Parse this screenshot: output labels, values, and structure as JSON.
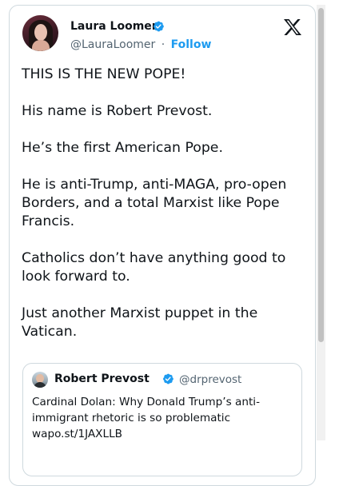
{
  "author": {
    "name": "Laura Loomer",
    "handle": "@LauraLoomer",
    "separator": "·",
    "follow_label": "Follow",
    "verified_icon": "verified-badge-icon",
    "badge_color": "#1d9bf0"
  },
  "platform_icon": "x-logo-icon",
  "tweet": {
    "paragraphs": [
      "THIS IS THE NEW POPE!",
      "His name is Robert Prevost.",
      "He’s the first American Pope.",
      "He is anti-Trump, anti-MAGA, pro-open Borders, and a total Marxist like Pope Francis.",
      "Catholics don’t have anything good to look forward to.",
      "Just another Marxist puppet in the Vatican."
    ]
  },
  "quoted": {
    "name": "Robert Prevost",
    "handle": "@drprevost",
    "verified_icon": "verified-badge-icon",
    "lines": [
      "Cardinal Dolan: Why Donald Trump’s anti-",
      "immigrant rhetoric is so problematic",
      "wapo.st/1JAXLLB"
    ]
  },
  "colors": {
    "accent": "#1d9bf0",
    "text": "#0f1419",
    "muted": "#536471",
    "border": "#cfd9de"
  }
}
